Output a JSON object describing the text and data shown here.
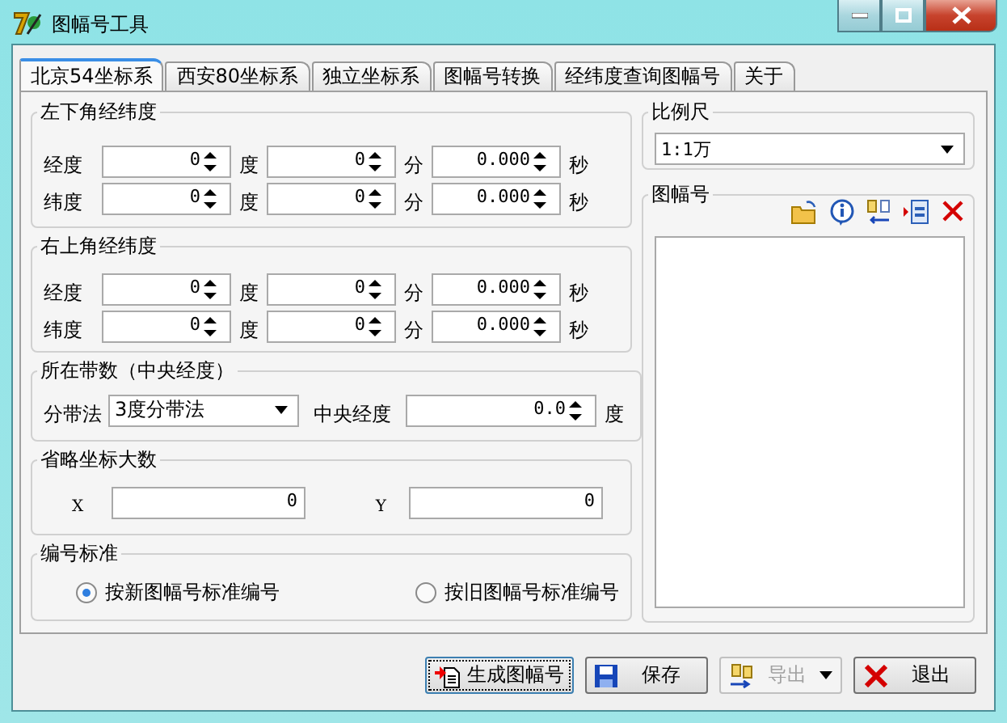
{
  "window": {
    "title": "图幅号工具"
  },
  "tabs": [
    {
      "label": "北京54坐标系",
      "selected": true
    },
    {
      "label": "西安80坐标系",
      "selected": false
    },
    {
      "label": "独立坐标系",
      "selected": false
    },
    {
      "label": "图幅号转换",
      "selected": false
    },
    {
      "label": "经纬度查询图幅号",
      "selected": false
    },
    {
      "label": "关于",
      "selected": false
    }
  ],
  "corner_groups": [
    {
      "title": "左下角经纬度",
      "rows": [
        {
          "label": "经度",
          "fields": [
            {
              "value": "0",
              "unit": "度"
            },
            {
              "value": "0",
              "unit": "分"
            },
            {
              "value": "0.000",
              "unit": "秒"
            }
          ]
        },
        {
          "label": "纬度",
          "fields": [
            {
              "value": "0",
              "unit": "度"
            },
            {
              "value": "0",
              "unit": "分"
            },
            {
              "value": "0.000",
              "unit": "秒"
            }
          ]
        }
      ]
    },
    {
      "title": "右上角经纬度",
      "rows": [
        {
          "label": "经度",
          "fields": [
            {
              "value": "0",
              "unit": "度"
            },
            {
              "value": "0",
              "unit": "分"
            },
            {
              "value": "0.000",
              "unit": "秒"
            }
          ]
        },
        {
          "label": "纬度",
          "fields": [
            {
              "value": "0",
              "unit": "度"
            },
            {
              "value": "0",
              "unit": "分"
            },
            {
              "value": "0.000",
              "unit": "秒"
            }
          ]
        }
      ]
    }
  ],
  "zone": {
    "title": "所在带数（中央经度）",
    "method_label": "分带法",
    "method_value": "3度分带法",
    "central_label": "中央经度",
    "central_value": "0.0",
    "central_unit": "度"
  },
  "false_coordinates": {
    "title": "省略坐标大数",
    "fields": [
      {
        "label": "X",
        "value": "0"
      },
      {
        "label": "Y",
        "value": "0"
      }
    ]
  },
  "numbering": {
    "title": "编号标准",
    "options": [
      {
        "label": "按新图幅号标准编号",
        "selected": true
      },
      {
        "label": "按旧图幅号标准编号",
        "selected": false
      }
    ]
  },
  "scale": {
    "title": "比例尺",
    "value": "1:1万"
  },
  "sheet_list": {
    "title": "图幅号"
  },
  "buttons": [
    {
      "kind": "generate",
      "label": "生成图幅号",
      "disabled": false,
      "focused": true
    },
    {
      "kind": "save",
      "label": "保存",
      "disabled": false,
      "focused": false
    },
    {
      "kind": "export",
      "label": "导出",
      "disabled": true,
      "focused": false
    },
    {
      "kind": "exit",
      "label": "退出",
      "disabled": false,
      "focused": false
    }
  ]
}
